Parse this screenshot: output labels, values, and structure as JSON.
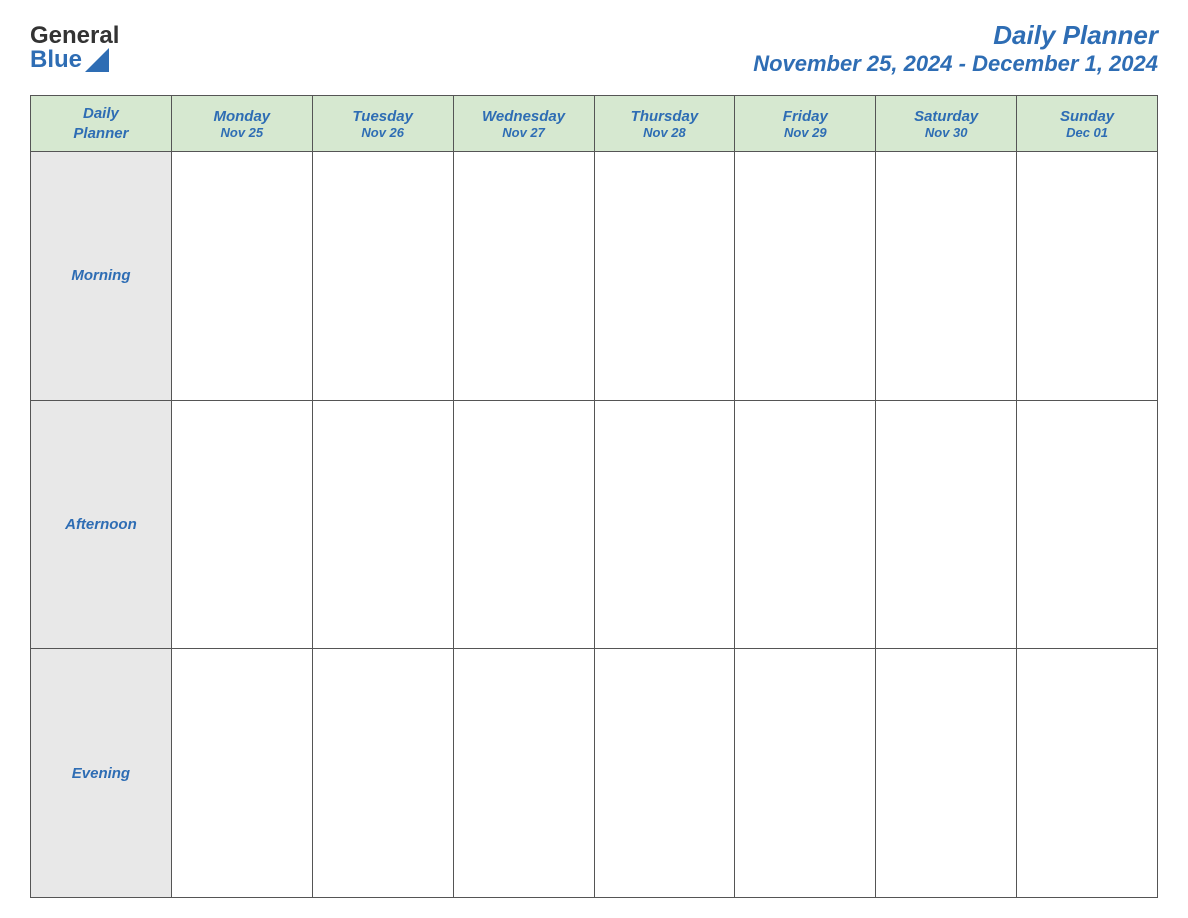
{
  "header": {
    "logo_line1": "General",
    "logo_line2": "Blue",
    "title": "Daily Planner",
    "subtitle": "November 25, 2024 - December 1, 2024"
  },
  "table": {
    "header_col1_line1": "Daily",
    "header_col1_line2": "Planner",
    "days": [
      {
        "name": "Monday",
        "date": "Nov 25"
      },
      {
        "name": "Tuesday",
        "date": "Nov 26"
      },
      {
        "name": "Wednesday",
        "date": "Nov 27"
      },
      {
        "name": "Thursday",
        "date": "Nov 28"
      },
      {
        "name": "Friday",
        "date": "Nov 29"
      },
      {
        "name": "Saturday",
        "date": "Nov 30"
      },
      {
        "name": "Sunday",
        "date": "Dec 01"
      }
    ],
    "periods": [
      "Morning",
      "Afternoon",
      "Evening"
    ]
  },
  "colors": {
    "header_bg": "#d6e8d0",
    "period_bg": "#e8e8e8",
    "day_bg": "#ffffff",
    "text_blue": "#2e6db4",
    "border": "#555555"
  }
}
